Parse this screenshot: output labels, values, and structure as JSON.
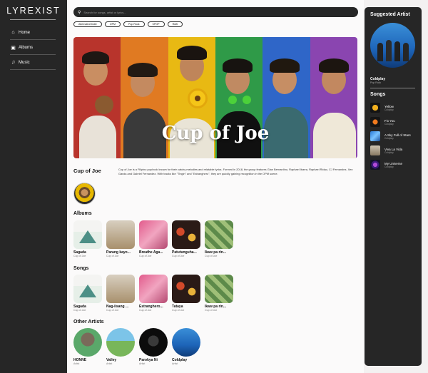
{
  "app": {
    "logo": "LYREXIST"
  },
  "nav": [
    {
      "label": "Home",
      "icon": "home-icon"
    },
    {
      "label": "Albums",
      "icon": "album-icon"
    },
    {
      "label": "Music",
      "icon": "music-note-icon"
    }
  ],
  "search": {
    "placeholder": "Search for songs, artist or lyrics..."
  },
  "genres": [
    "Alternative/Indie",
    "OPM",
    "Pop Rock",
    "KPOP",
    "R&B"
  ],
  "artist": {
    "banner_title": "Cup of Joe",
    "name": "Cup of Joe",
    "bio": "Cup of Joe is a Filipino pop/rock known for their catchy melodies and relatable lyrics. Formed in 2018, the group features Gian Bernardino, Raphael Ibarra, Raphael Ridao, CJ Fernandez, Xen Garcia and Gabriel Fernandez. With tracks like \"Tingin\" and \"Estranghero\", they are quickly gaining recognition in the OPM scene."
  },
  "albums": {
    "title": "Albums",
    "items": [
      {
        "title": "Sagada",
        "artist": "Cup of Joe"
      },
      {
        "title": "Parang kayo...",
        "artist": "Cup of Joe"
      },
      {
        "title": "Breathe Aga...",
        "artist": "Cup of Joe"
      },
      {
        "title": "Patutunguha...",
        "artist": "Cup of Joe"
      },
      {
        "title": "Ikaw pa rin...",
        "artist": "Cup of Joe"
      }
    ]
  },
  "songs_main": {
    "title": "Songs",
    "items": [
      {
        "title": "Sagada",
        "artist": "Cup of Joe"
      },
      {
        "title": "Nag-iisang ...",
        "artist": "Cup of Joe"
      },
      {
        "title": "Estranghero...",
        "artist": "Cup of Joe"
      },
      {
        "title": "Tataya",
        "artist": "Cup of Joe"
      },
      {
        "title": "Ikaw pa rin...",
        "artist": "Cup of Joe"
      }
    ]
  },
  "other_artists": {
    "title": "Other Artists",
    "items": [
      {
        "name": "HONNE",
        "role": "Artist"
      },
      {
        "name": "Valley",
        "role": "Artist"
      },
      {
        "name": "Parokya Ni",
        "role": "Artist"
      },
      {
        "name": "Coldplay",
        "role": "Artist"
      }
    ]
  },
  "suggested": {
    "title": "Suggested Artist",
    "name": "Coldplay",
    "genre": "Pop Rock",
    "songs_title": "Songs",
    "songs": [
      {
        "title": "Yellow",
        "artist": "Coldplay"
      },
      {
        "title": "Fix You",
        "artist": "Coldplay"
      },
      {
        "title": "A Sky Full of Stars",
        "artist": "Coldplay"
      },
      {
        "title": "Viva La Vida",
        "artist": "Coldplay"
      },
      {
        "title": "My Universe",
        "artist": "Coldplay"
      }
    ]
  },
  "colors": {
    "sidebar": "#262626",
    "banner_stripes": [
      "#c0392b",
      "#e67e22",
      "#f1c40f",
      "#27ae60",
      "#2e6fd1",
      "#8e44ad"
    ]
  }
}
